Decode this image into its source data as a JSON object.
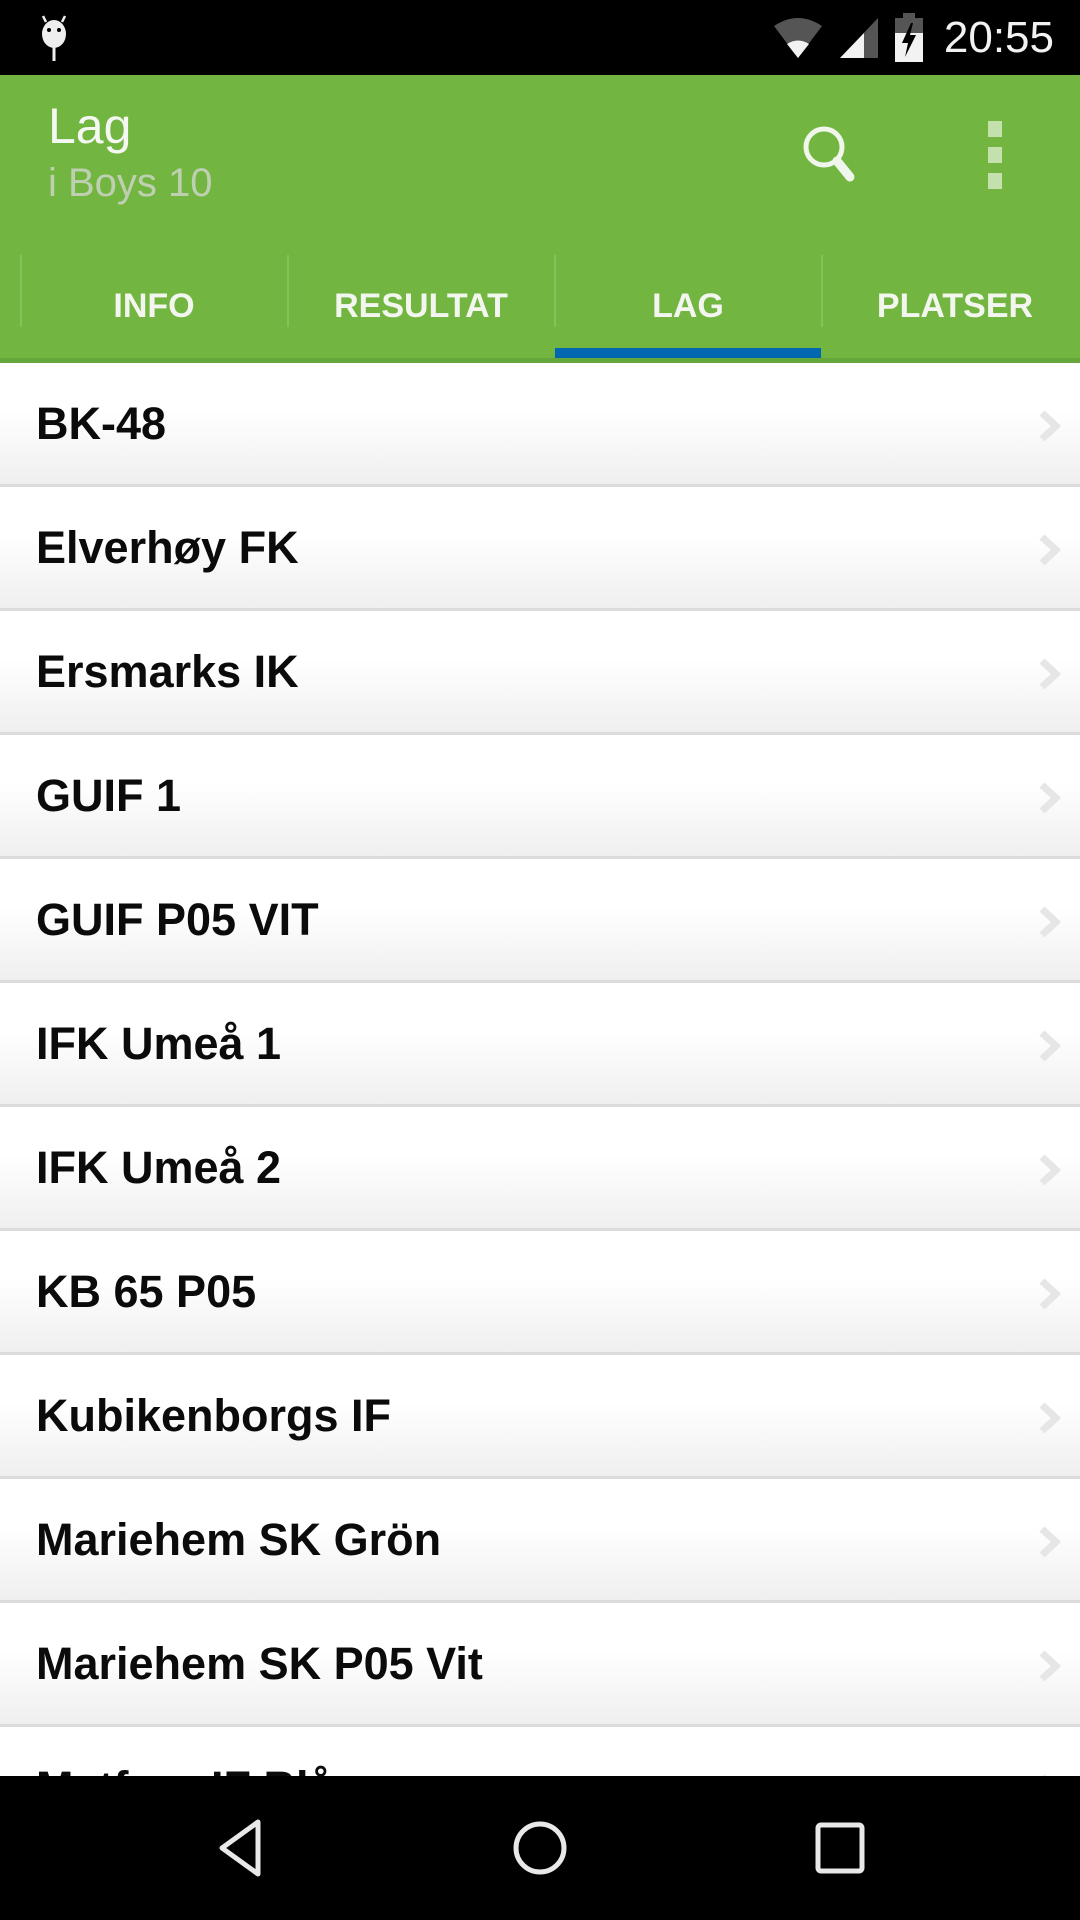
{
  "status_bar": {
    "notification_icon": "android-debug-icon",
    "icons": [
      "wifi-icon",
      "cell-signal-icon",
      "battery-charging-icon"
    ],
    "time": "20:55"
  },
  "app_bar": {
    "title": "Lag",
    "subtitle": "i Boys 10",
    "actions": [
      "search-icon",
      "overflow-menu-icon"
    ],
    "color": "#72b641"
  },
  "tabs": {
    "items": [
      {
        "label": "INFO",
        "selected": false
      },
      {
        "label": "RESULTAT",
        "selected": false
      },
      {
        "label": "LAG",
        "selected": true
      },
      {
        "label": "PLATSER",
        "selected": false
      }
    ],
    "indicator_color": "#0068b1"
  },
  "teams": {
    "items": [
      {
        "name": "BK-48"
      },
      {
        "name": "Elverhøy FK"
      },
      {
        "name": "Ersmarks IK"
      },
      {
        "name": "GUIF 1"
      },
      {
        "name": "GUIF P05 VIT"
      },
      {
        "name": "IFK Umeå 1"
      },
      {
        "name": "IFK Umeå 2"
      },
      {
        "name": "KB 65 P05"
      },
      {
        "name": "Kubikenborgs IF"
      },
      {
        "name": "Mariehem SK Grön"
      },
      {
        "name": "Mariehem SK P05 Vit"
      },
      {
        "name": "Matfors IF Blå"
      }
    ]
  },
  "nav_bar": {
    "buttons": [
      "back-icon",
      "home-icon",
      "recents-icon"
    ]
  }
}
